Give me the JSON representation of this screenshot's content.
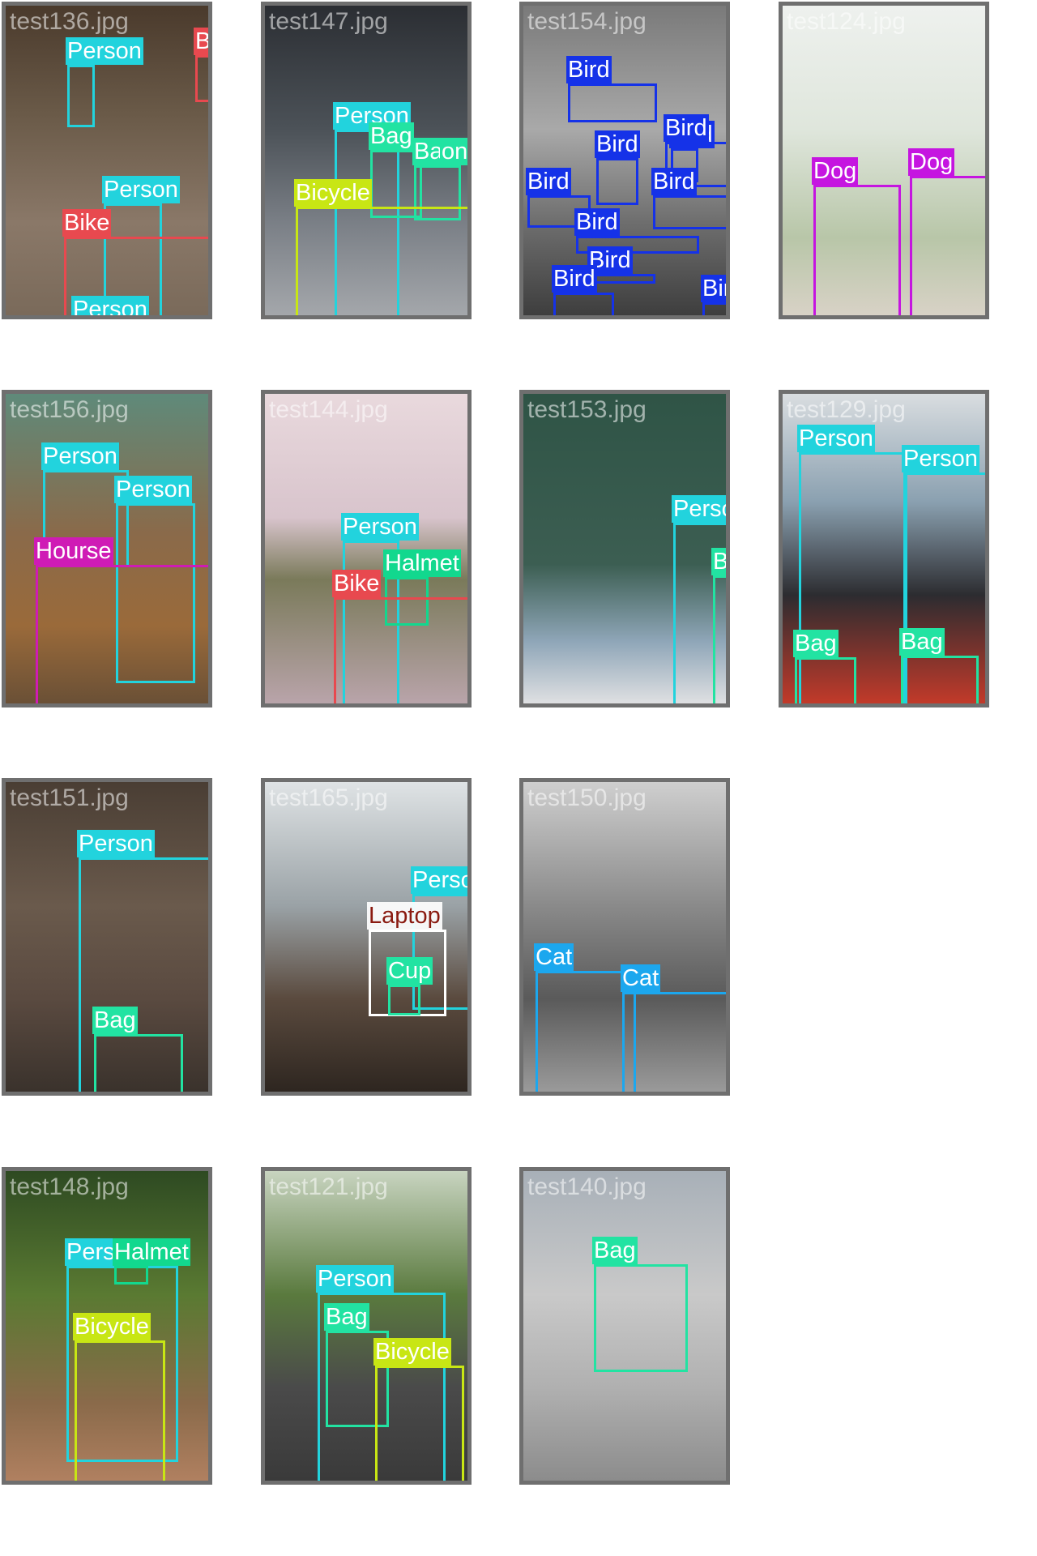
{
  "colors": {
    "person": "#22d3dd",
    "bike": "#e8494f",
    "bag": "#22e3a2",
    "bicycle": "#c8e614",
    "bird": "#1532e8",
    "dog": "#c515e0",
    "hourse": "#cf1bb5",
    "halmet": "#12d88e",
    "laptop": "#ffffff",
    "cup": "#22e3a2",
    "cat": "#1ca7ee"
  },
  "tiles": [
    {
      "filename": "test136.jpg",
      "bg": "linear-gradient(180deg,#4a3a2c 0%,#6a5a48 35%,#8a7868 70%,#7a6a5a 100%)",
      "detections": [
        {
          "label": "Person",
          "cls": "person"
        },
        {
          "label": "Bike",
          "cls": "bike"
        },
        {
          "label": "Person",
          "cls": "person"
        },
        {
          "label": "Bike",
          "cls": "bike"
        },
        {
          "label": "Person",
          "cls": "person"
        }
      ]
    },
    {
      "filename": "test147.jpg",
      "bg": "linear-gradient(180deg,#2b2e33 0%,#4c5258 40%,#7a7f86 70%,#a4a7ab 100%)",
      "detections": [
        {
          "label": "Person",
          "cls": "person"
        },
        {
          "label": "Bag",
          "cls": "bag"
        },
        {
          "label": "Bag",
          "cls": "bag"
        },
        {
          "label": "on",
          "cls": "bag"
        },
        {
          "label": "Bicycle",
          "cls": "bicycle"
        }
      ]
    },
    {
      "filename": "test154.jpg",
      "bg": "linear-gradient(180deg,#7a7a7a 0%,#a9a9a9 40%,#6e6e6e 70%,#3e3e3e 100%)",
      "detections": [
        {
          "label": "Bird",
          "cls": "bird"
        },
        {
          "label": "Bird",
          "cls": "bird"
        },
        {
          "label": "Bird",
          "cls": "bird"
        },
        {
          "label": "Bird",
          "cls": "bird"
        },
        {
          "label": "Bird",
          "cls": "bird"
        },
        {
          "label": "Bird",
          "cls": "bird"
        },
        {
          "label": "Bird",
          "cls": "bird"
        },
        {
          "label": "Bird",
          "cls": "bird"
        },
        {
          "label": "Bird",
          "cls": "bird"
        },
        {
          "label": "Bird",
          "cls": "bird"
        }
      ]
    },
    {
      "filename": "test124.jpg",
      "bg": "linear-gradient(180deg,#eef1ee 0%,#dfe6dc 40%,#b8c6a8 75%,#d8d2c6 100%)",
      "detections": [
        {
          "label": "Dog",
          "cls": "dog"
        },
        {
          "label": "Dog",
          "cls": "dog"
        }
      ]
    },
    {
      "filename": "test156.jpg",
      "bg": "linear-gradient(180deg,#5f8a7a 0%,#8a6a4a 45%,#9a6a3a 75%,#6a5036 100%)",
      "detections": [
        {
          "label": "Person",
          "cls": "person"
        },
        {
          "label": "Person",
          "cls": "person"
        },
        {
          "label": "Hourse",
          "cls": "hourse"
        }
      ]
    },
    {
      "filename": "test144.jpg",
      "bg": "linear-gradient(180deg,#e9d9dd 0%,#d8c4cc 40%,#7a7a5a 60%,#b9a4aa 100%)",
      "detections": [
        {
          "label": "Person",
          "cls": "person"
        },
        {
          "label": "Halmet",
          "cls": "halmet"
        },
        {
          "label": "Bike",
          "cls": "bike"
        }
      ]
    },
    {
      "filename": "test153.jpg",
      "bg": "linear-gradient(180deg,#2f5446 0%,#3c5e52 55%,#8fa6b8 80%,#dfe0e2 100%)",
      "detections": [
        {
          "label": "Person",
          "cls": "person"
        },
        {
          "label": "Bag",
          "cls": "bag"
        }
      ]
    },
    {
      "filename": "test129.jpg",
      "bg": "linear-gradient(180deg,#d9dde0 0%,#8aa0b0 35%,#2c2c30 65%,#c23a2a 100%)",
      "detections": [
        {
          "label": "Person",
          "cls": "person"
        },
        {
          "label": "Person",
          "cls": "person"
        },
        {
          "label": "Bag",
          "cls": "bag"
        },
        {
          "label": "Bag",
          "cls": "bag"
        }
      ]
    },
    {
      "filename": "test151.jpg",
      "bg": "linear-gradient(180deg,#4a3e34 0%,#6a5a4c 40%,#5a4a40 70%,#3a322c 100%)",
      "detections": [
        {
          "label": "Person",
          "cls": "person"
        },
        {
          "label": "Bag",
          "cls": "bag"
        }
      ]
    },
    {
      "filename": "test165.jpg",
      "bg": "linear-gradient(180deg,#dfe3e5 0%,#9aa2a6 40%,#5a4a3e 70%,#2e2620 100%)",
      "detections": [
        {
          "label": "Person",
          "cls": "person"
        },
        {
          "label": "Laptop",
          "cls": "laptop"
        },
        {
          "label": "Cup",
          "cls": "cup"
        }
      ]
    },
    {
      "filename": "test150.jpg",
      "bg": "linear-gradient(180deg,#cfcfcf 0%,#8a8a8a 40%,#5a5a5a 70%,#9a9a9a 100%)",
      "detections": [
        {
          "label": "Cat",
          "cls": "cat"
        },
        {
          "label": "Cat",
          "cls": "cat"
        }
      ]
    },
    {
      "filename": "test148.jpg",
      "bg": "linear-gradient(180deg,#2e4a22 0%,#5a7a32 40%,#8a6a4a 75%,#b08060 100%)",
      "detections": [
        {
          "label": "Person",
          "cls": "person"
        },
        {
          "label": "Halmet",
          "cls": "halmet"
        },
        {
          "label": "Bicycle",
          "cls": "bicycle"
        }
      ]
    },
    {
      "filename": "test121.jpg",
      "bg": "linear-gradient(180deg,#c8d4c0 0%,#5a7a3e 40%,#4a4a4a 70%,#3a3a3a 100%)",
      "detections": [
        {
          "label": "Person",
          "cls": "person"
        },
        {
          "label": "Bag",
          "cls": "bag"
        },
        {
          "label": "Bicycle",
          "cls": "bicycle"
        }
      ]
    },
    {
      "filename": "test140.jpg",
      "bg": "linear-gradient(180deg,#a8b0b8 0%,#c9c9c9 40%,#b0b0b0 70%,#8c8c8c 100%)",
      "detections": [
        {
          "label": "Bag",
          "cls": "bag"
        }
      ]
    }
  ]
}
